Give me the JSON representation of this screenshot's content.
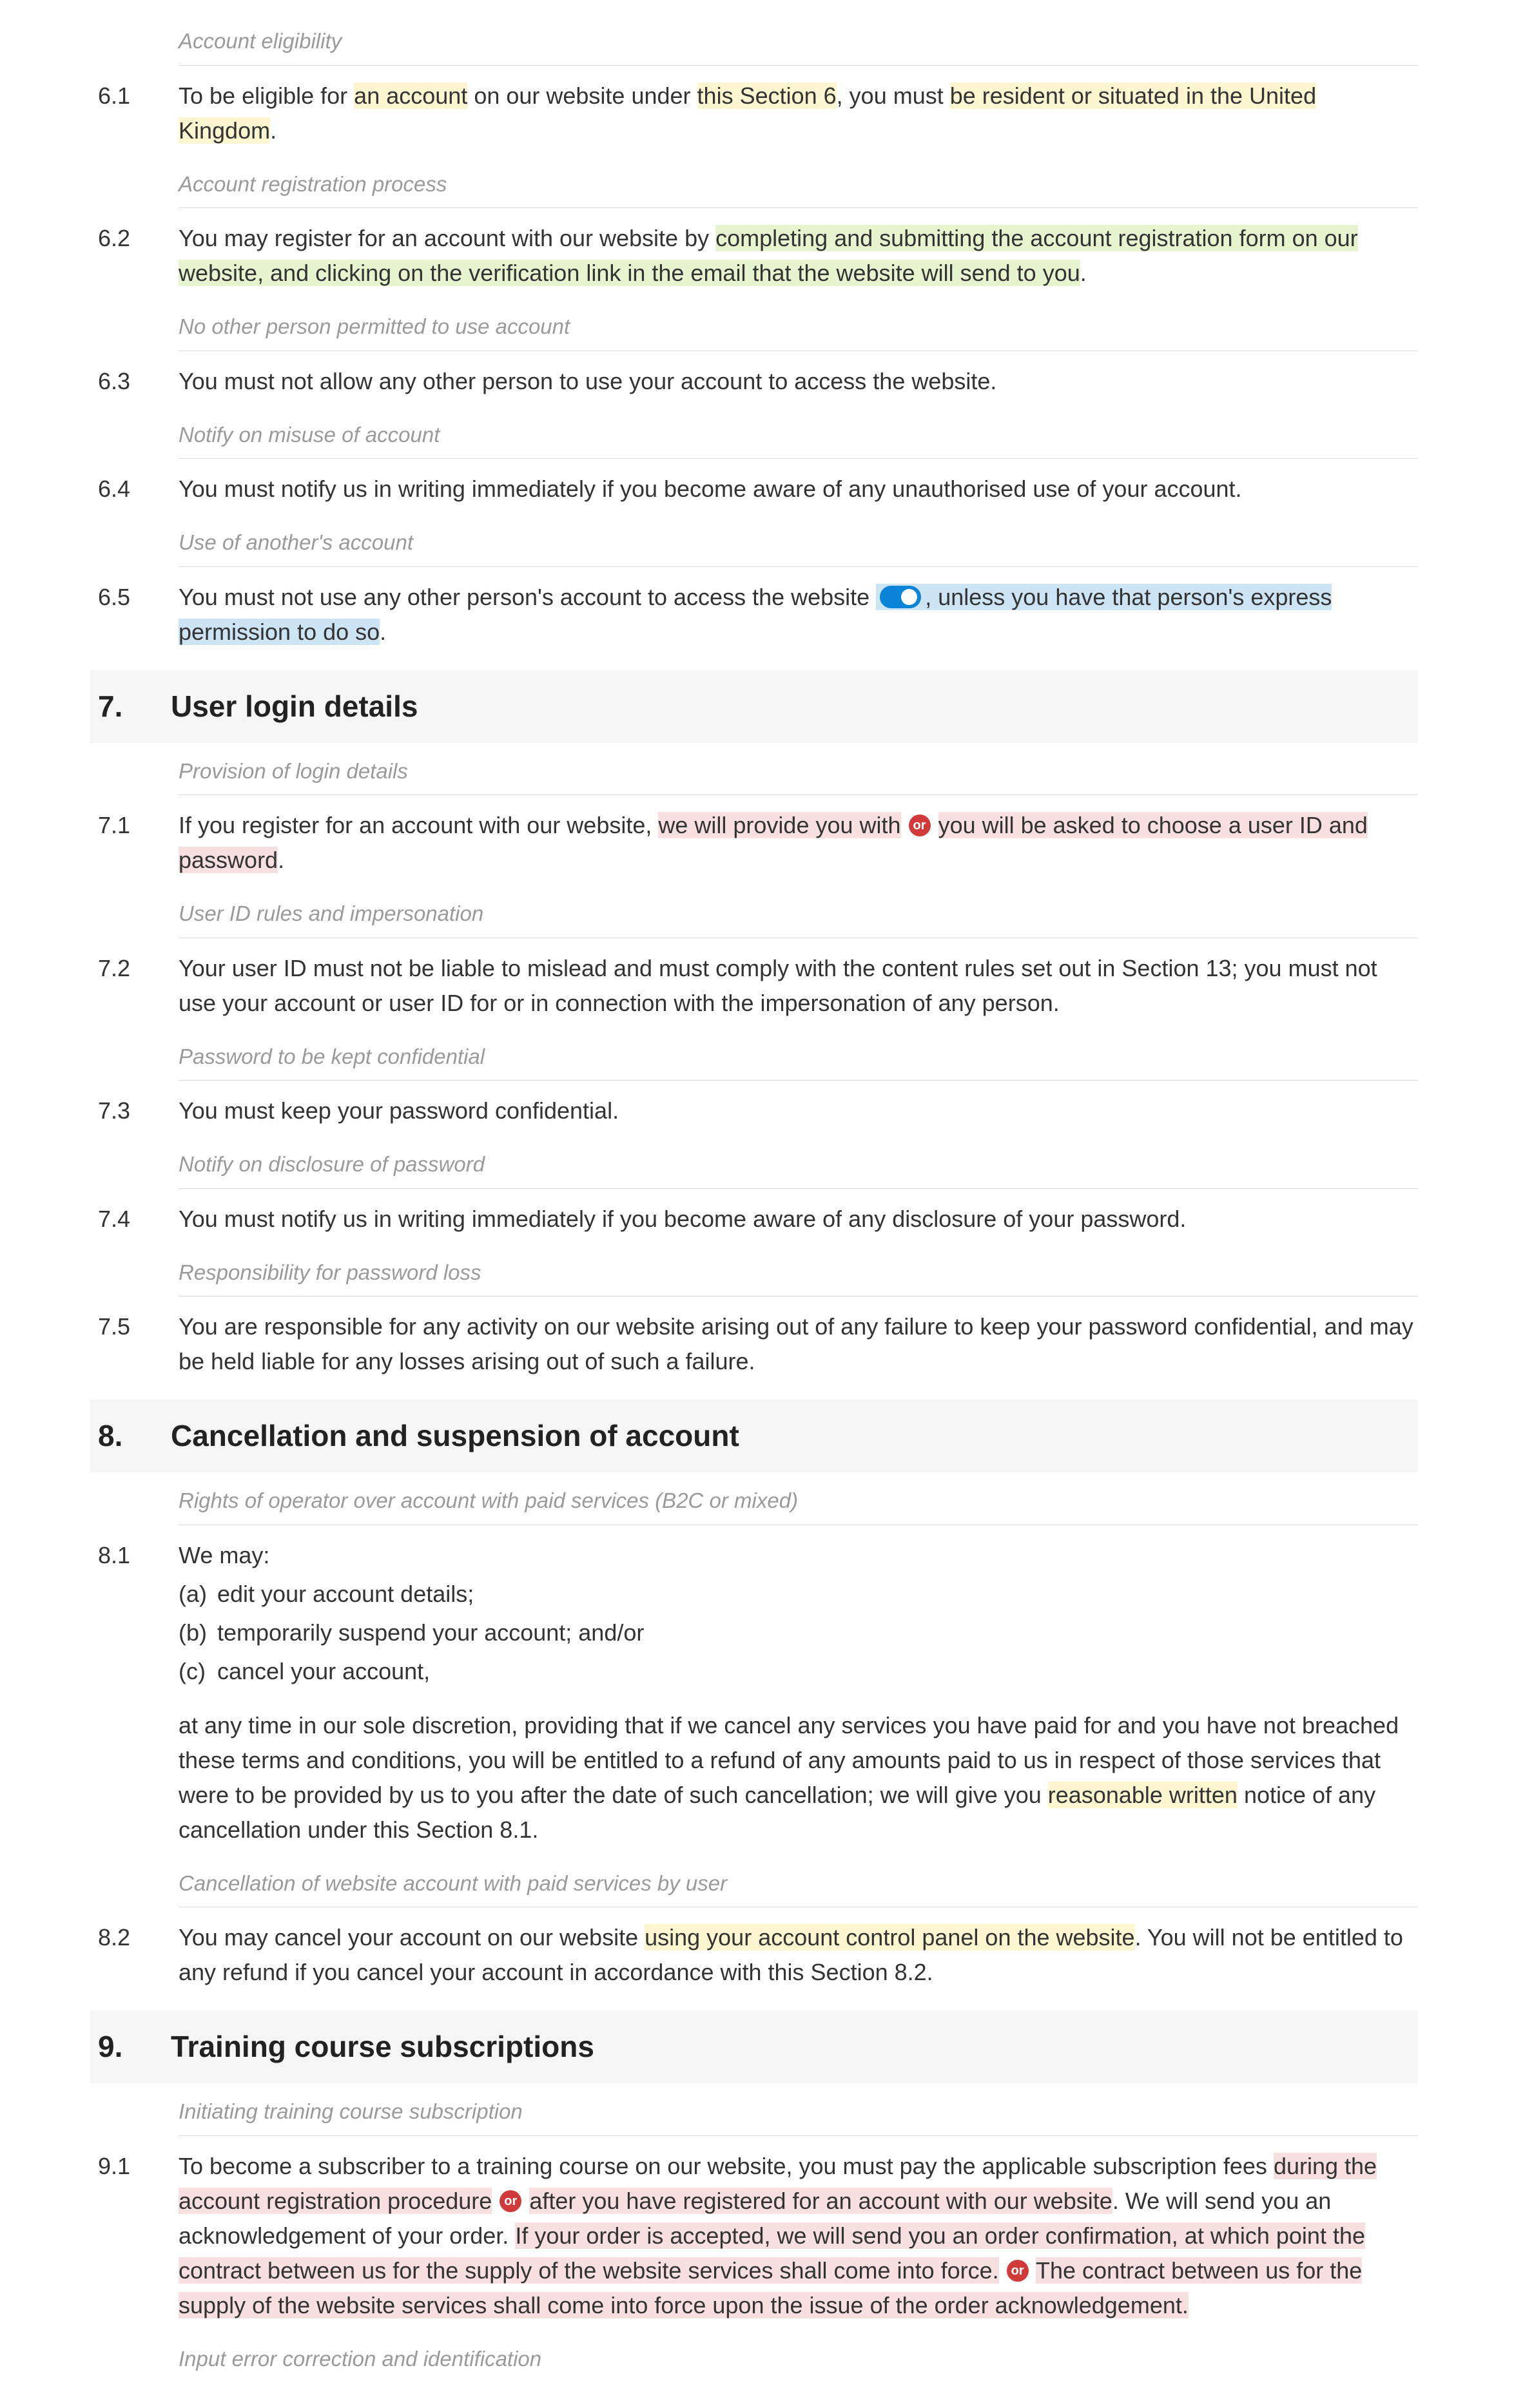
{
  "or_label": "or",
  "labels": {
    "s6_1": "Account eligibility",
    "s6_2": "Account registration process",
    "s6_3": "No other person permitted to use account",
    "s6_4": "Notify on misuse of account",
    "s6_5": "Use of another's account",
    "s7_1": "Provision of login details",
    "s7_2": "User ID rules and impersonation",
    "s7_3": "Password to be kept confidential",
    "s7_4": "Notify on disclosure of password",
    "s7_5": "Responsibility for password loss",
    "s8_1": "Rights of operator over account with paid services (B2C or mixed)",
    "s8_2": "Cancellation of website account with paid services by user",
    "s9_1": "Initiating training course subscription",
    "s9_2": "Input error correction and identification"
  },
  "nums": {
    "c6_1": "6.1",
    "c6_2": "6.2",
    "c6_3": "6.3",
    "c6_4": "6.4",
    "c6_5": "6.5",
    "s7n": "7.",
    "s7t": "User login details",
    "c7_1": "7.1",
    "c7_2": "7.2",
    "c7_3": "7.3",
    "c7_4": "7.4",
    "c7_5": "7.5",
    "s8n": "8.",
    "s8t": "Cancellation and suspension of account",
    "c8_1": "8.1",
    "c8_2": "8.2",
    "s9n": "9.",
    "s9t": "Training course subscriptions",
    "c9_1": "9.1"
  },
  "t6_1": {
    "a": "To be eligible for ",
    "b": "an account",
    "c": " on our website under ",
    "d": "this Section 6",
    "e": ", you must ",
    "f": "be resident or situated in the United Kingdom",
    "g": "."
  },
  "t6_2": {
    "a": "You may register for an account with our website by ",
    "b": "completing and submitting the account registration form on our website, and clicking on the verification link in the email that the website will send to you",
    "c": "."
  },
  "t6_3": "You must not allow any other person to use your account to access the website.",
  "t6_4": "You must notify us in writing immediately if you become aware of any unauthorised use of your account.",
  "t6_5": {
    "a": "You must not use any other person's account to access the website",
    "b": ", unless you have that person's express permission to do so",
    "c": "."
  },
  "t7_1": {
    "a": "If you register for an account with our website, ",
    "b": "we will provide you with",
    "c": "you will be asked to choose",
    "d": " a user ID and password",
    "e": "."
  },
  "t7_2": "Your user ID must not be liable to mislead and must comply with the content rules set out in Section 13; you must not use your account or user ID for or in connection with the impersonation of any person.",
  "t7_3": "You must keep your password confidential.",
  "t7_4": "You must notify us in writing immediately if you become aware of any disclosure of your password.",
  "t7_5": "You are responsible for any activity on our website arising out of any failure to keep your password confidential, and may be held liable for any losses arising out of such a failure.",
  "t8_1": {
    "lead": "We may:",
    "a_l": "(a)",
    "a": "edit your account details;",
    "b_l": "(b)",
    "b": "temporarily suspend your account; and/or",
    "c_l": "(c)",
    "c": "cancel your account,",
    "trail_a": "at any time in our sole discretion, providing that if we cancel any services you have paid for and you have not breached these terms and conditions, you will be entitled to a refund of any amounts paid to us in respect of those services that were to be provided by us to you after the date of such cancellation; we will give you ",
    "trail_b": "reasonable written",
    "trail_c": " notice of any cancellation under this Section 8.1."
  },
  "t8_2": {
    "a": "You may cancel your account on our website ",
    "b": "using your account control panel on the website",
    "c": ". You will not be entitled to any refund if you cancel your account in accordance with this Section 8.2."
  },
  "t9_1": {
    "a": "To become a subscriber to a training course on our website, you must pay the applicable subscription fees ",
    "b": "during the account registration procedure",
    "c": "after you have registered for an account with our website",
    "d": ". We will send you an acknowledgement of your order. ",
    "e": "If your order is accepted, we will send you an order confirmation, at which point the contract between us for the supply of the website services shall come into force.",
    "f": "The contract between us for the supply of the website services shall come into force upon the issue of the order acknowledgement."
  }
}
